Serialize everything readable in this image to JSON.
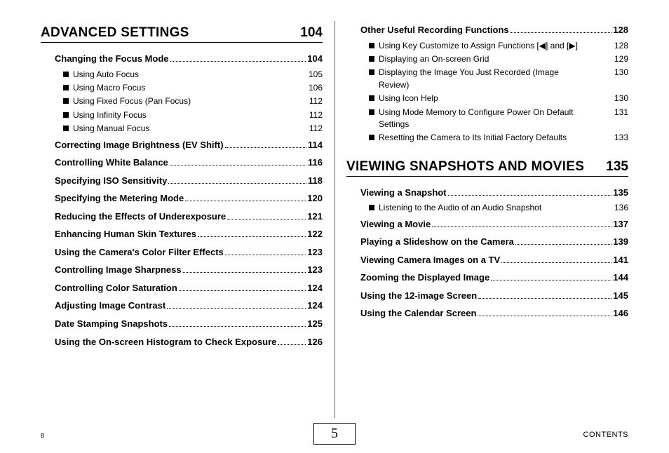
{
  "footer": {
    "left": "B",
    "right": "CONTENTS",
    "page": "5"
  },
  "left": {
    "chapter": {
      "title": "ADVANCED SETTINGS",
      "page": "104"
    },
    "items": [
      {
        "t": "section",
        "label": "Changing the Focus Mode",
        "page": "104"
      },
      {
        "t": "sub",
        "label": "Using Auto Focus",
        "page": "105"
      },
      {
        "t": "sub",
        "label": "Using Macro Focus",
        "page": "106"
      },
      {
        "t": "sub",
        "label": "Using Fixed Focus (Pan Focus)",
        "page": "112"
      },
      {
        "t": "sub",
        "label": "Using Infinity Focus",
        "page": "112"
      },
      {
        "t": "sub",
        "label": "Using Manual Focus",
        "page": "112"
      },
      {
        "t": "section",
        "label": "Correcting Image Brightness (EV Shift)",
        "page": "114"
      },
      {
        "t": "section",
        "label": "Controlling White Balance",
        "page": "116"
      },
      {
        "t": "section",
        "label": "Specifying ISO Sensitivity",
        "page": "118"
      },
      {
        "t": "section",
        "label": "Specifying the Metering Mode",
        "page": "120"
      },
      {
        "t": "section",
        "label": "Reducing the Effects of Underexposure",
        "page": "121"
      },
      {
        "t": "section",
        "label": "Enhancing Human Skin Textures",
        "page": "122"
      },
      {
        "t": "section",
        "label": "Using the Camera's Color Filter Effects",
        "page": "123"
      },
      {
        "t": "section",
        "label": "Controlling Image Sharpness",
        "page": "123"
      },
      {
        "t": "section",
        "label": "Controlling Color Saturation",
        "page": "124"
      },
      {
        "t": "section",
        "label": "Adjusting Image Contrast",
        "page": "124"
      },
      {
        "t": "section",
        "label": "Date Stamping Snapshots",
        "page": "125"
      },
      {
        "t": "section",
        "label": "Using the On-screen Histogram to Check Exposure",
        "page": "126"
      }
    ]
  },
  "right": {
    "topItems": [
      {
        "t": "section",
        "label": "Other Useful Recording Functions",
        "page": "128"
      },
      {
        "t": "sub",
        "label": "Using Key Customize to Assign Functions [◀] and [▶]",
        "page": "128"
      },
      {
        "t": "sub",
        "label": "Displaying an On-screen Grid",
        "page": "129"
      },
      {
        "t": "sub",
        "label": "Displaying the Image You Just Recorded (Image Review)",
        "page": "130"
      },
      {
        "t": "sub",
        "label": "Using Icon Help",
        "page": "130"
      },
      {
        "t": "sub",
        "label": "Using Mode Memory to Configure Power On Default Settings",
        "page": "131"
      },
      {
        "t": "sub",
        "label": "Resetting the Camera to Its Initial Factory Defaults",
        "page": "133"
      }
    ],
    "chapter": {
      "title": "VIEWING SNAPSHOTS AND MOVIES",
      "page": "135"
    },
    "items": [
      {
        "t": "section",
        "label": "Viewing a Snapshot",
        "page": "135"
      },
      {
        "t": "sub",
        "label": "Listening to the Audio of an Audio Snapshot",
        "page": "136"
      },
      {
        "t": "section",
        "label": "Viewing a Movie",
        "page": "137"
      },
      {
        "t": "section",
        "label": "Playing a Slideshow on the Camera",
        "page": "139"
      },
      {
        "t": "section",
        "label": "Viewing Camera Images on a TV",
        "page": "141"
      },
      {
        "t": "section",
        "label": "Zooming the Displayed Image",
        "page": "144"
      },
      {
        "t": "section",
        "label": "Using the 12-image Screen",
        "page": "145"
      },
      {
        "t": "section",
        "label": "Using the Calendar Screen",
        "page": "146"
      }
    ]
  }
}
